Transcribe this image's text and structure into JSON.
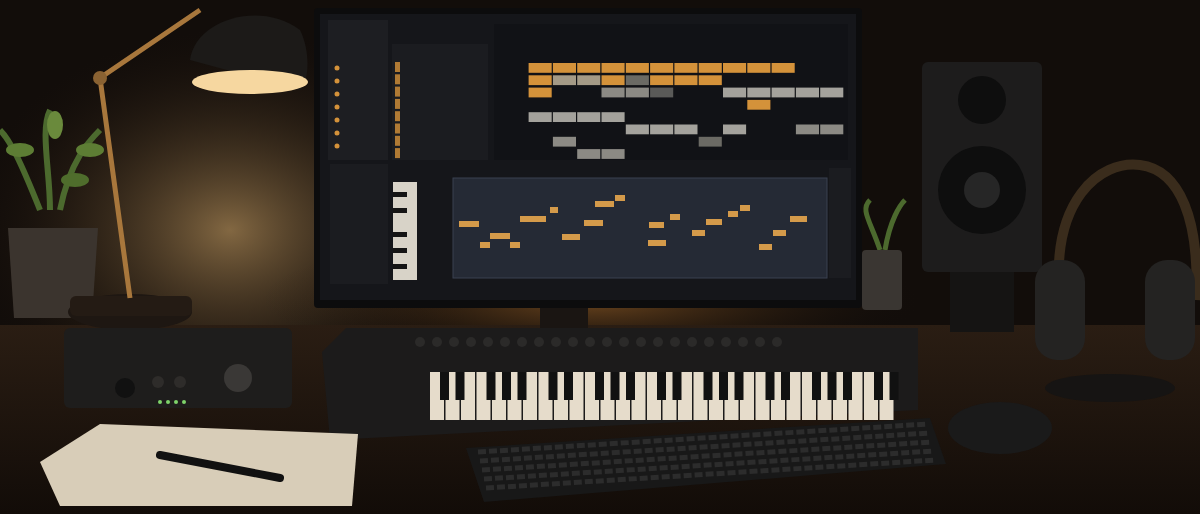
{
  "arrangement": {
    "rows": [
      {
        "cells": [
          {
            "color": "#d4923a"
          },
          {
            "color": "#d4923a"
          },
          {
            "color": "#d4923a"
          },
          {
            "color": "#d4923a"
          },
          {
            "color": "#d4923a"
          },
          {
            "color": "#d4923a"
          },
          {
            "color": "#d4923a"
          },
          {
            "color": "#d4923a"
          },
          {
            "color": "#d4923a"
          },
          {
            "color": "#d4923a"
          },
          {
            "color": "#d4923a"
          },
          null,
          null
        ]
      },
      {
        "cells": [
          {
            "color": "#d4923a"
          },
          {
            "color": "#a49a86"
          },
          {
            "color": "#a49a86"
          },
          {
            "color": "#d4923a"
          },
          {
            "color": "#6b6a64"
          },
          {
            "color": "#d4923a"
          },
          {
            "color": "#d4923a"
          },
          {
            "color": "#d4923a"
          },
          null,
          null,
          null,
          null,
          null
        ]
      },
      {
        "cells": [
          {
            "color": "#d4923a"
          },
          null,
          null,
          {
            "color": "#8c8a84"
          },
          {
            "color": "#8c8a84"
          },
          {
            "color": "#5a5a58"
          },
          null,
          null,
          {
            "color": "#a4a29c"
          },
          {
            "color": "#a4a29c"
          },
          {
            "color": "#a4a29c"
          },
          {
            "color": "#a4a29c"
          },
          {
            "color": "#a4a29c"
          }
        ]
      },
      {
        "cells": [
          null,
          null,
          null,
          null,
          null,
          null,
          null,
          null,
          null,
          {
            "color": "#d4923a"
          },
          null,
          null,
          null
        ]
      },
      {
        "cells": [
          {
            "color": "#a4a29c"
          },
          {
            "color": "#a4a29c"
          },
          {
            "color": "#a4a29c"
          },
          {
            "color": "#a4a29c"
          },
          null,
          null,
          null,
          null,
          null,
          null,
          null,
          null,
          null
        ]
      },
      {
        "cells": [
          null,
          null,
          null,
          null,
          {
            "color": "#a4a29c"
          },
          {
            "color": "#a4a29c"
          },
          {
            "color": "#a4a29c"
          },
          null,
          {
            "color": "#a4a29c"
          },
          null,
          null,
          {
            "color": "#8c8a84"
          },
          {
            "color": "#8c8a84"
          }
        ]
      },
      {
        "cells": [
          null,
          {
            "color": "#8c8a84"
          },
          null,
          null,
          null,
          null,
          null,
          {
            "color": "#6b6a64"
          },
          null,
          null,
          null,
          null,
          null
        ]
      },
      {
        "cells": [
          null,
          null,
          {
            "color": "#8c8a84"
          },
          {
            "color": "#8c8a84"
          },
          null,
          null,
          null,
          null,
          null,
          null,
          null,
          null,
          null
        ]
      }
    ]
  }
}
